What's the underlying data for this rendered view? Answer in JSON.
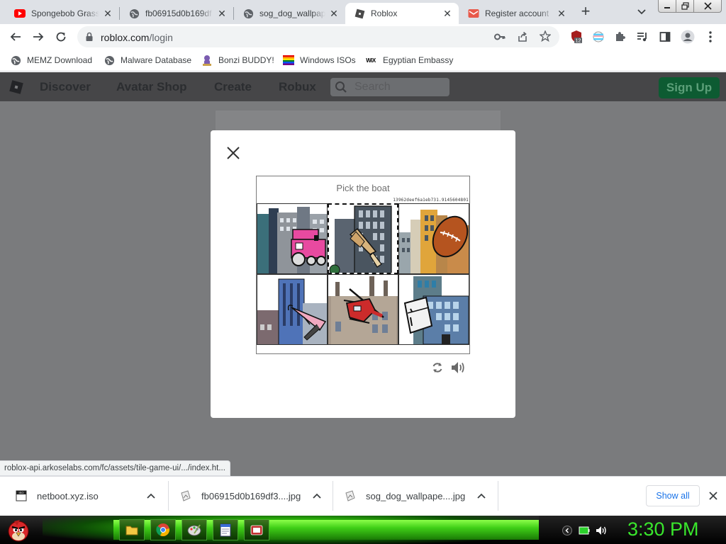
{
  "browser": {
    "tabs": [
      {
        "title": "Spongebob Grass",
        "favicon": "youtube-icon",
        "active": false
      },
      {
        "title": "fb06915d0b169df",
        "favicon": "globe-icon",
        "active": false
      },
      {
        "title": "sog_dog_wallpape",
        "favicon": "globe-icon",
        "active": false
      },
      {
        "title": "Roblox",
        "favicon": "roblox-icon",
        "active": true
      },
      {
        "title": "Register account",
        "favicon": "mail-icon",
        "active": false
      }
    ],
    "new_tab_symbol": "+",
    "url": {
      "host": "roblox.com",
      "path": "/login"
    },
    "extensions_badge": "12",
    "bookmarks": [
      {
        "label": "MEMZ Download",
        "icon": "globe-icon"
      },
      {
        "label": "Malware Database",
        "icon": "globe-icon"
      },
      {
        "label": "Bonzi BUDDY!",
        "icon": "bonzi-icon"
      },
      {
        "label": "Windows ISOs",
        "icon": "rainbow-flag-icon"
      },
      {
        "label": "Egyptian Embassy",
        "icon": "wix-icon"
      }
    ],
    "wix_icon_text": "WiX",
    "status_bubble": "roblox-api.arkoselabs.com/fc/assets/tile-game-ui/.../index.ht..."
  },
  "roblox": {
    "nav": {
      "discover": "Discover",
      "avatar_shop": "Avatar Shop",
      "create": "Create",
      "robux": "Robux"
    },
    "search_placeholder": "Search",
    "signup_label": "Sign Up"
  },
  "captcha": {
    "prompt": "Pick the boat",
    "session_id": "13962deef6a1eb731.9145604801",
    "tiles": [
      {
        "object": "train",
        "selected": false
      },
      {
        "object": "shovel",
        "selected": true
      },
      {
        "object": "football",
        "selected": false
      },
      {
        "object": "pen",
        "selected": false
      },
      {
        "object": "helicopter",
        "selected": false
      },
      {
        "object": "refrigerator",
        "selected": false
      }
    ]
  },
  "downloads": {
    "items": [
      {
        "name": "netboot.xyz.iso"
      },
      {
        "name": "fb06915d0b169df3....jpg"
      },
      {
        "name": "sog_dog_wallpape....jpg"
      }
    ],
    "show_all_label": "Show all"
  },
  "taskbar": {
    "clock": "3:30 PM"
  },
  "colors": {
    "accent_green": "#39e62c",
    "signup_green": "#00b06f",
    "link_blue": "#1a73e8"
  }
}
